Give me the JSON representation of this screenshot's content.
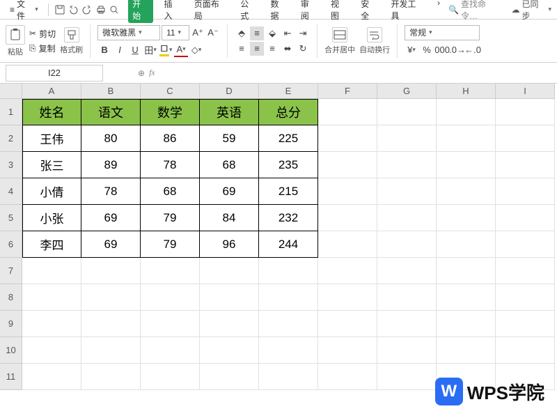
{
  "menubar": {
    "file_label": "文件",
    "tabs": [
      "开始",
      "插入",
      "页面布局",
      "公式",
      "数据",
      "审阅",
      "视图",
      "安全",
      "开发工具"
    ],
    "more": "›",
    "search_placeholder": "查找命令…",
    "sync_label": "已同步"
  },
  "ribbon": {
    "paste_label": "粘贴",
    "cut_label": "剪切",
    "copy_label": "复制",
    "format_painter_label": "格式刷",
    "font_name": "微软雅黑",
    "font_size": "11",
    "merge_label": "合并居中",
    "wrap_label": "自动换行",
    "number_format_label": "常规"
  },
  "formula_bar": {
    "cell_ref": "I22",
    "fx": "fx"
  },
  "grid": {
    "columns": [
      "A",
      "B",
      "C",
      "D",
      "E",
      "F",
      "G",
      "H",
      "I"
    ],
    "row_numbers": [
      1,
      2,
      3,
      4,
      5,
      6,
      7,
      8,
      9,
      10,
      11
    ],
    "headers": [
      "姓名",
      "语文",
      "数学",
      "英语",
      "总分"
    ],
    "data": [
      [
        "王伟",
        "80",
        "86",
        "59",
        "225"
      ],
      [
        "张三",
        "89",
        "78",
        "68",
        "235"
      ],
      [
        "小倩",
        "78",
        "68",
        "69",
        "215"
      ],
      [
        "小张",
        "69",
        "79",
        "84",
        "232"
      ],
      [
        "李四",
        "69",
        "79",
        "96",
        "244"
      ]
    ]
  },
  "watermark": {
    "logo": "W",
    "text": "WPS学院"
  },
  "chart_data": {
    "type": "table",
    "title": "",
    "columns": [
      "姓名",
      "语文",
      "数学",
      "英语",
      "总分"
    ],
    "rows": [
      {
        "姓名": "王伟",
        "语文": 80,
        "数学": 86,
        "英语": 59,
        "总分": 225
      },
      {
        "姓名": "张三",
        "语文": 89,
        "数学": 78,
        "英语": 68,
        "总分": 235
      },
      {
        "姓名": "小倩",
        "语文": 78,
        "数学": 68,
        "英语": 69,
        "总分": 215
      },
      {
        "姓名": "小张",
        "语文": 69,
        "数学": 79,
        "英语": 84,
        "总分": 232
      },
      {
        "姓名": "李四",
        "语文": 69,
        "数学": 79,
        "英语": 96,
        "总分": 244
      }
    ]
  }
}
